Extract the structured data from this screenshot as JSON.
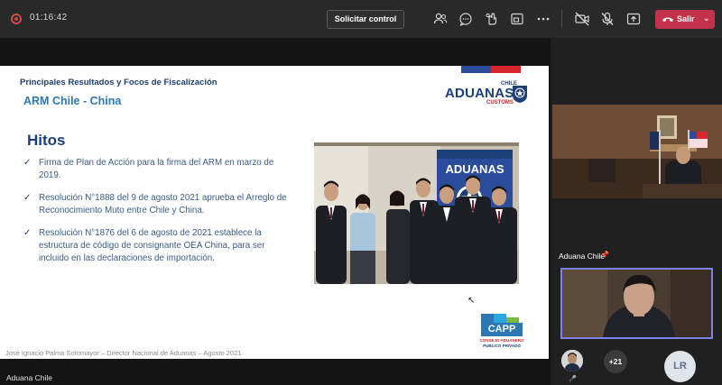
{
  "toolbar": {
    "timer": "01:16:42",
    "request_control_label": "Solicitar control",
    "leave_label": "Salir",
    "icons": [
      "people-icon",
      "chat-icon",
      "reactions-icon",
      "share-tray-icon",
      "more-icon",
      "camera-off-icon",
      "mic-off-icon",
      "share-icon"
    ],
    "leave_color": "#c4314b"
  },
  "slide": {
    "kicker": "Principales Resultados y Focos de Fiscalización",
    "subtitle": "ARM Chile - China",
    "logo": {
      "top": "CHILE",
      "main": "ADUANAS",
      "bottom": "CUSTOMS"
    },
    "heading": "Hitos",
    "bullets": [
      "Firma de Plan de Acción para la firma del ARM en marzo de 2019.",
      "Resolución N°1888 del 9 de agosto 2021 aprueba el Arreglo de Reconocimiento Muto entre Chile y China.",
      "Resolución N°1876 del 6 de agosto de 2021 establece la estructura de código de consignante OEA China, para ser incluido en las declaraciones de importación."
    ],
    "photo_banner_text": "ADUANAS",
    "capp_logo": {
      "word": "CAPP",
      "line1": "CONSEJO ADUANERO",
      "line2": "PUBLICO PRIVADO"
    },
    "footer": "José Ignacio Palma Sotomayor – Director Nacional de Aduanas – Agosto 2021",
    "accent_color": "#1d3f77"
  },
  "presenter_name": "Aduana Chile",
  "rail": {
    "participant_name": "Aduana Chile",
    "more_count": "+21",
    "initials": "LR"
  }
}
